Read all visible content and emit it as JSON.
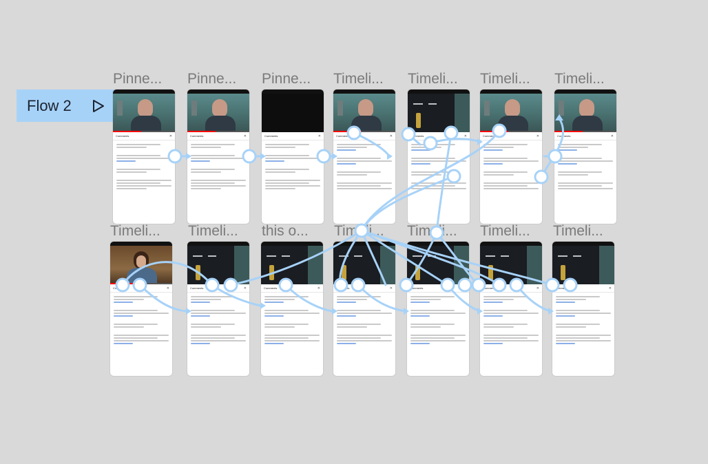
{
  "flow": {
    "label": "Flow 2"
  },
  "colors": {
    "canvas": "#d9d9d9",
    "accent": "#a7d2f8",
    "connector": "#a7d2f8"
  },
  "frames": [
    {
      "title": "Pinne...",
      "screen": "person",
      "header": "Comments"
    },
    {
      "title": "Pinne...",
      "screen": "person",
      "header": "Comments"
    },
    {
      "title": "Pinne...",
      "screen": "black",
      "header": "Comments"
    },
    {
      "title": "Timeli...",
      "screen": "person",
      "header": "Comments"
    },
    {
      "title": "Timeli...",
      "screen": "dark",
      "header": "Comments"
    },
    {
      "title": "Timeli...",
      "screen": "person",
      "header": "Comments"
    },
    {
      "title": "Timeli...",
      "screen": "person",
      "header": "Comments"
    },
    {
      "title": "Timeli...",
      "screen": "room",
      "header": "Comments"
    },
    {
      "title": "Timeli...",
      "screen": "dark",
      "header": "Comments"
    },
    {
      "title": "this o...",
      "screen": "dark",
      "header": "Comments"
    },
    {
      "title": "Timeli...",
      "screen": "dark",
      "header": "Comments"
    },
    {
      "title": "Timeli...",
      "screen": "dark",
      "header": "Comments"
    },
    {
      "title": "Timeli...",
      "screen": "dark",
      "header": "Comments"
    },
    {
      "title": "Timeli...",
      "screen": "dark",
      "header": "Comments"
    }
  ]
}
